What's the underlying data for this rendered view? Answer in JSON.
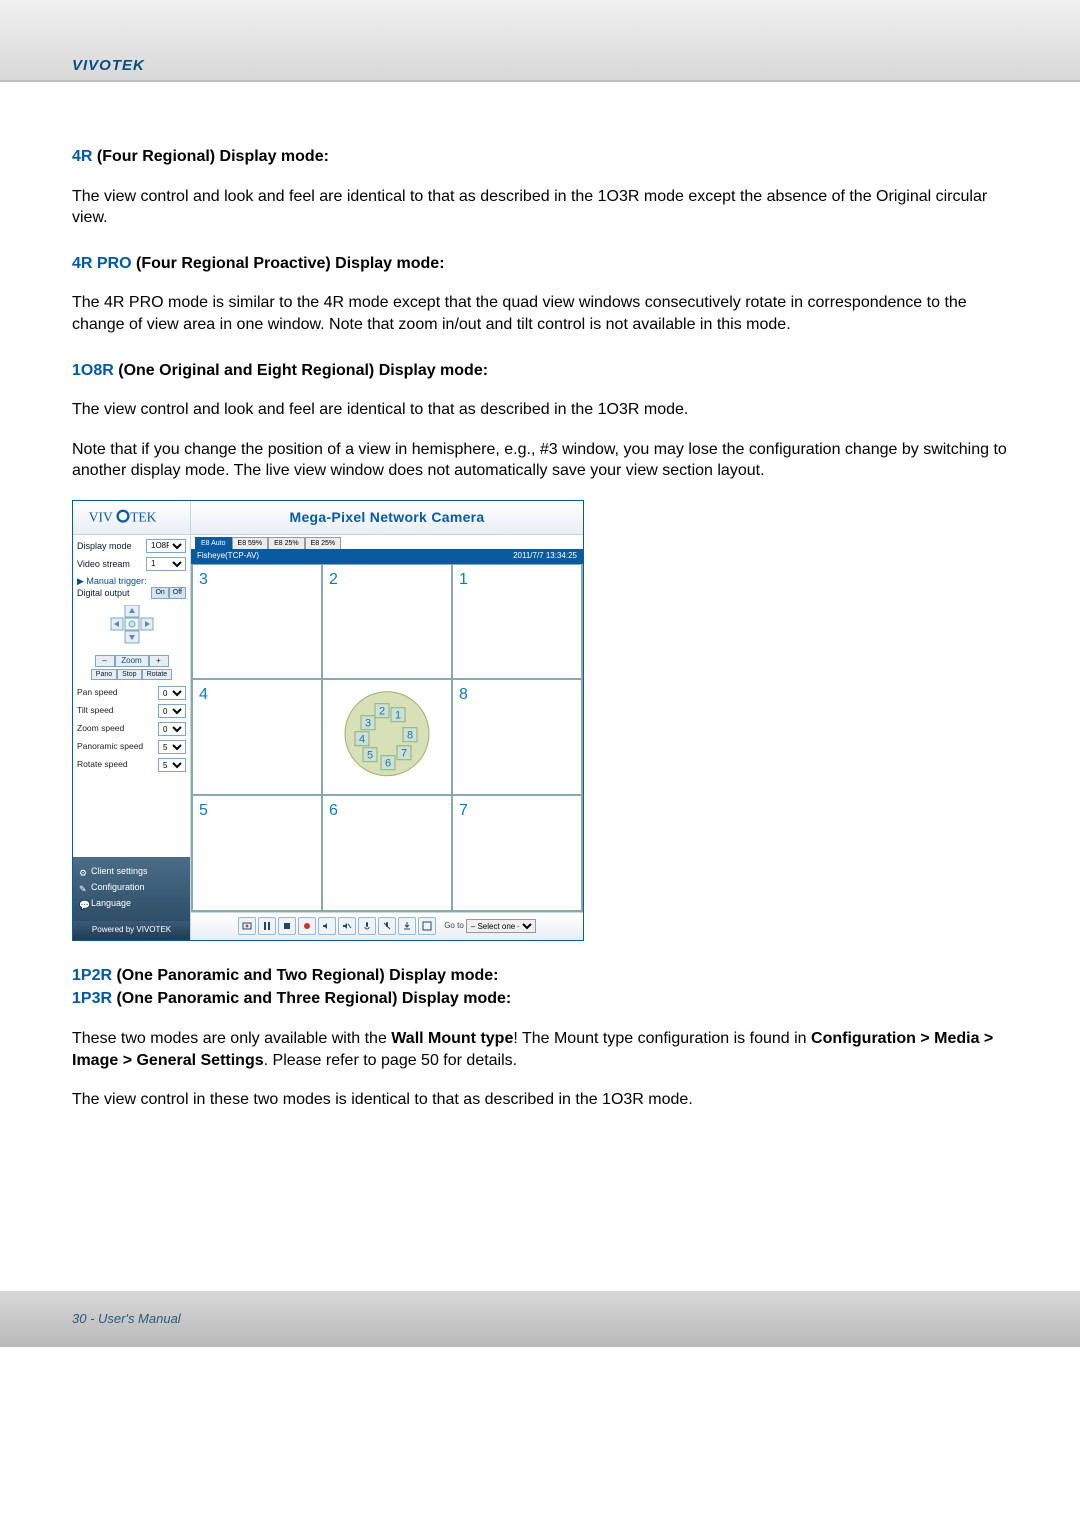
{
  "header": {
    "brand": "Vivotek"
  },
  "footer": {
    "page": "30 - User's Manual"
  },
  "sections": {
    "s4r": {
      "code": "4R",
      "title_rest": " (Four Regional) Display mode:",
      "p1": "The view control and look and feel are identical to that as described in the 1O3R mode except the absence of the Original circular view."
    },
    "s4rpro": {
      "code": "4R PRO",
      "title_rest": " (Four Regional Proactive) Display mode:",
      "p1": "The 4R PRO mode is similar to the 4R mode except that the quad view windows consecutively rotate in correspondence to the change of view area in one window. Note that zoom in/out and tilt control is not available in this mode."
    },
    "s1o8r": {
      "code": "1O8R",
      "title_rest": " (One Original and Eight Regional) Display mode:",
      "p1": "The view control and look and feel are identical to that as described in the 1O3R mode.",
      "p2": "Note that if you change the position of a view in hemisphere, e.g., #3 window, you may lose the configuration change by switching to another display mode. The live view window does not automatically save your view section layout."
    },
    "s1p2r": {
      "code": "1P2R",
      "title_rest": " (One Panoramic and Two Regional) Display mode:"
    },
    "s1p3r": {
      "code": "1P3R",
      "title_rest": " (One Panoramic and Three Regional) Display mode:"
    },
    "wallmount": {
      "p1a": "These two modes are only available with the ",
      "p1b": "Wall Mount type",
      "p1c": "! The Mount type configuration is found in ",
      "p1d": "Configuration > Media > Image > General Settings",
      "p1e": ". Please refer to page 50 for details.",
      "p2": "The view control in these two modes is identical to that as described in the 1O3R mode."
    }
  },
  "ui": {
    "title": "Mega-Pixel Network Camera",
    "tabs": [
      "E8 Auto",
      "E8 59%",
      "E8 25%",
      "E8 25%"
    ],
    "stream_left": "Fisheye(TCP-AV)",
    "stream_right": "2011/7/7 13:34:25",
    "sidebar": {
      "display_mode_label": "Display mode",
      "display_mode_value": "1O8R",
      "video_stream_label": "Video stream",
      "video_stream_value": "1",
      "manual_trigger": "Manual trigger:",
      "digital_output_label": "Digital output",
      "digital_on": "On",
      "digital_off": "Off",
      "zoom_minus": "–",
      "zoom_label": "Zoom",
      "zoom_plus": "+",
      "mini_tabs": [
        "Pano",
        "Stop",
        "Rotate"
      ],
      "speeds": [
        {
          "label": "Pan speed",
          "value": "0"
        },
        {
          "label": "Tilt speed",
          "value": "0"
        },
        {
          "label": "Zoom speed",
          "value": "0"
        },
        {
          "label": "Panoramic speed",
          "value": "5"
        },
        {
          "label": "Rotate speed",
          "value": "5"
        }
      ],
      "links": [
        "Client settings",
        "Configuration",
        "Language"
      ],
      "powered": "Powered by VIVOTEK"
    },
    "cells": [
      "3",
      "2",
      "1",
      "4",
      "",
      "8",
      "5",
      "6",
      "7"
    ],
    "hemi_labels": [
      "1",
      "2",
      "3",
      "4",
      "5",
      "6",
      "7",
      "8"
    ],
    "playbar": {
      "goto_label": "Go to",
      "goto_value": "– Select one –"
    }
  }
}
